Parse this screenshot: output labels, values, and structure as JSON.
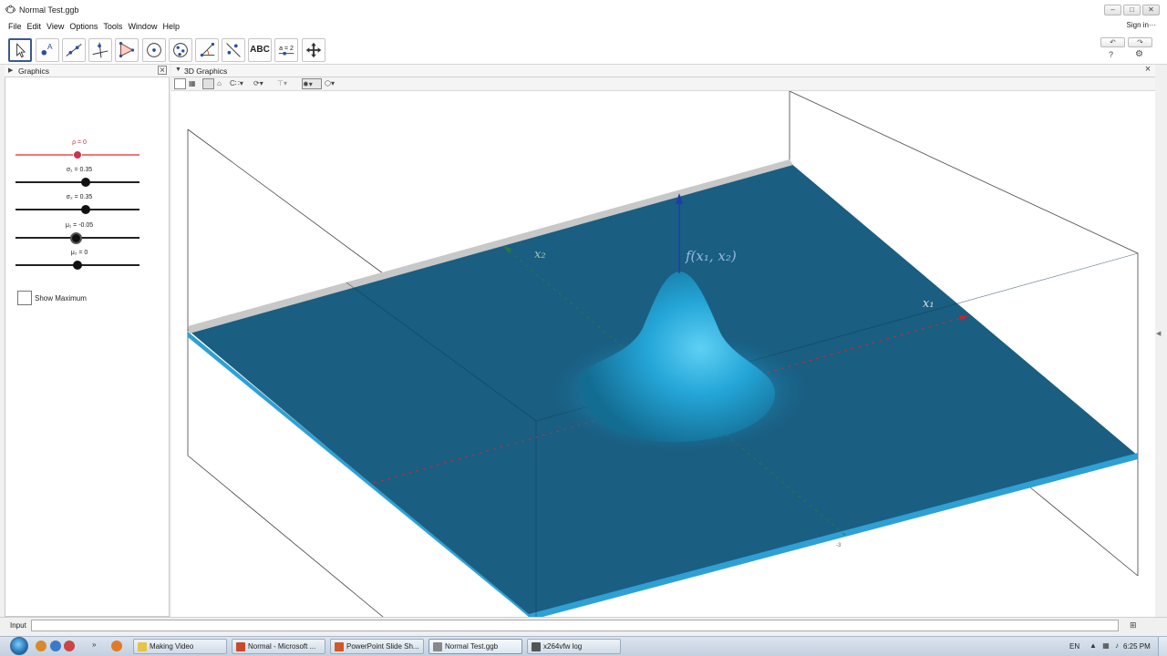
{
  "window": {
    "title": "Normal Test.ggb",
    "sign_in": "Sign in···"
  },
  "menu": [
    "File",
    "Edit",
    "View",
    "Options",
    "Tools",
    "Window",
    "Help"
  ],
  "toolbar": {
    "tools": [
      "move-tool",
      "point-tool",
      "line-tool",
      "perpendicular-tool",
      "polygon-tool",
      "circle-tool",
      "conic-tool",
      "angle-tool",
      "reflect-tool",
      "ABC",
      "a = 2",
      "move-graphics-tool"
    ],
    "text_tool_label": "ABC",
    "slider_tool_label": "a = 2",
    "undo": "undo-icon",
    "redo": "redo-icon",
    "help": "?",
    "settings": "gear-icon"
  },
  "graphics_panel": {
    "title": "Graphics",
    "sliders": [
      {
        "label": "ρ = 0",
        "value": 0,
        "min": -1,
        "max": 1,
        "color": "#d03050"
      },
      {
        "label": "σ₁ = 0.35",
        "value": 0.35,
        "min": 0,
        "max": 0.7,
        "color": "#111111"
      },
      {
        "label": "σ₂ = 0.35",
        "value": 0.35,
        "min": 0,
        "max": 0.7,
        "color": "#111111"
      },
      {
        "label": "μ₁ = -0.05",
        "value": -0.05,
        "min": -0.5,
        "max": 0.5,
        "color": "#111111"
      },
      {
        "label": "μ₂ = 0",
        "value": 0,
        "min": -0.5,
        "max": 0.5,
        "color": "#111111"
      }
    ],
    "checkbox": {
      "label": "Show Maximum",
      "checked": false
    }
  },
  "graphics3d": {
    "title": "3D Graphics",
    "z_label": "f(x₁, x₂)",
    "x1_label": "x₁",
    "x2_label": "x₂",
    "plane_color": "#1a5e82",
    "surface_color": "#2ea0d4",
    "tick_label": "-3"
  },
  "input_bar": {
    "label": "Input",
    "value": ""
  },
  "taskbar": {
    "tasks": [
      {
        "label": "Making Video",
        "color": "#e8c24a"
      },
      {
        "label": "Normal - Microsoft ...",
        "color": "#c84a2a"
      },
      {
        "label": "PowerPoint Slide Sh...",
        "color": "#d0582a"
      },
      {
        "label": "Normal Test.ggb",
        "color": "#888888",
        "active": true
      },
      {
        "label": "x264vfw log",
        "color": "#555555"
      }
    ],
    "language": "EN",
    "clock": "6:25 PM"
  }
}
